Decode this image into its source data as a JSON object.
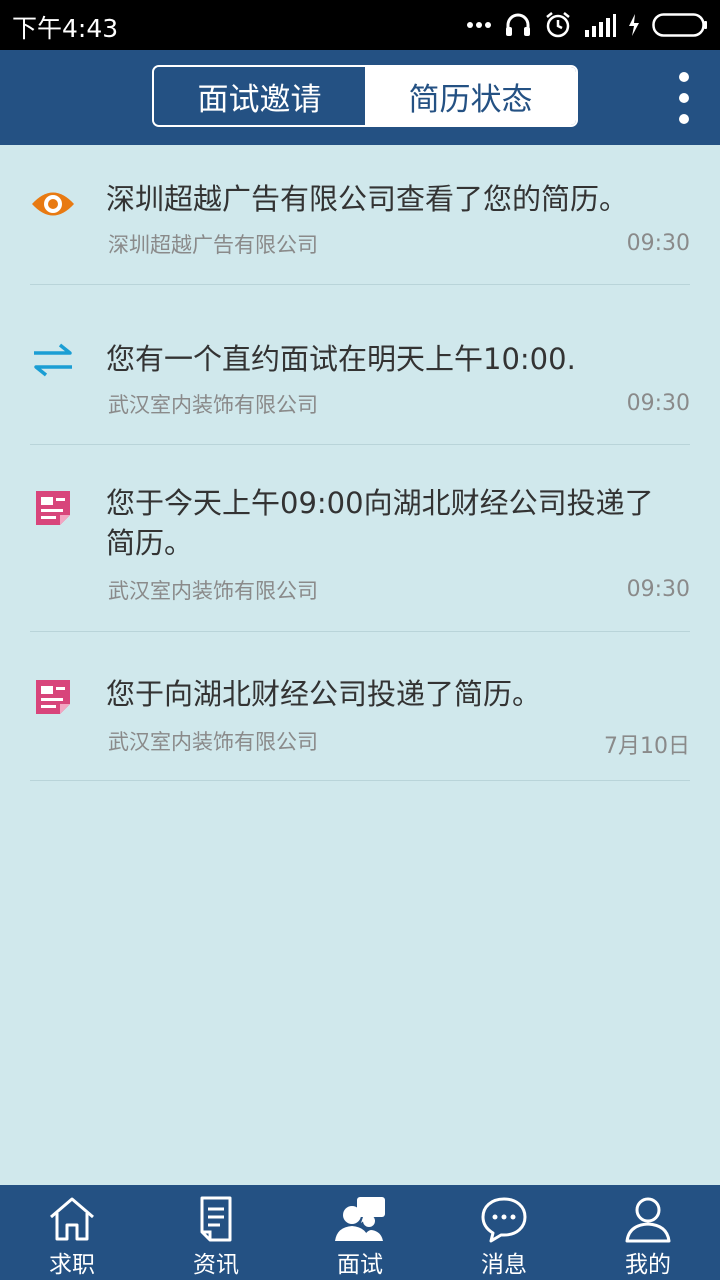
{
  "status_bar": {
    "time": "下午4:43",
    "icons": [
      "more-dots-icon",
      "headset-icon",
      "alarm-icon",
      "signal-icon",
      "charging-icon",
      "battery-icon"
    ]
  },
  "header": {
    "tabs": [
      {
        "label": "面试邀请",
        "active": false
      },
      {
        "label": "简历状态",
        "active": true
      }
    ],
    "menu_icon": "more-vertical-icon"
  },
  "colors": {
    "header_bg": "#245183",
    "page_bg": "#d0e8ec",
    "eye_orange": "#e87a12",
    "swap_blue": "#1a9ed4",
    "resume_pink": "#d8457b"
  },
  "messages": [
    {
      "icon": "eye-icon",
      "title": "深圳超越广告有限公司查看了您的简历。",
      "company": "深圳超越广告有限公司",
      "time": "09:30"
    },
    {
      "icon": "swap-arrows-icon",
      "title": "您有一个直约面试在明天上午10:00.",
      "company": "武汉室内装饰有限公司",
      "time": "09:30"
    },
    {
      "icon": "resume-icon",
      "title": "您于今天上午09:00向湖北财经公司投递了简历。",
      "company": "武汉室内装饰有限公司",
      "time": "09:30"
    },
    {
      "icon": "resume-icon",
      "title": "您于向湖北财经公司投递了简历。",
      "company": "武汉室内装饰有限公司",
      "time": "7月10日"
    }
  ],
  "tabbar": {
    "items": [
      {
        "label": "求职",
        "icon": "home-icon"
      },
      {
        "label": "资讯",
        "icon": "document-icon"
      },
      {
        "label": "面试",
        "icon": "interview-icon"
      },
      {
        "label": "消息",
        "icon": "chat-icon"
      },
      {
        "label": "我的",
        "icon": "user-icon"
      }
    ]
  }
}
